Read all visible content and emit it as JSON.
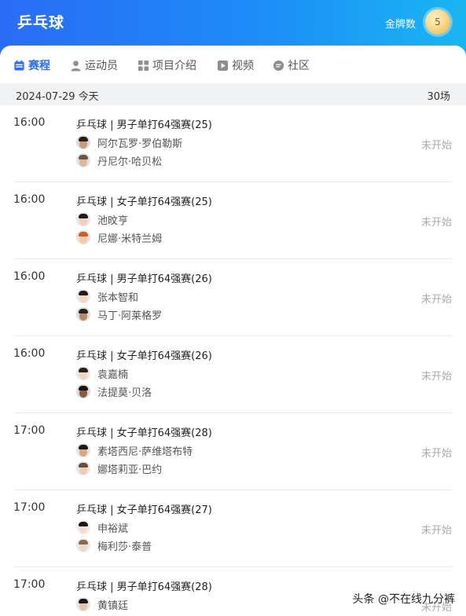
{
  "header": {
    "title": "乒乓球",
    "medal_label": "金牌数",
    "medal_count": "5"
  },
  "nav": {
    "items": [
      {
        "label": "赛程",
        "icon": "calendar-icon",
        "active": true
      },
      {
        "label": "运动员",
        "icon": "person-icon",
        "active": false
      },
      {
        "label": "项目介绍",
        "icon": "grid-icon",
        "active": false
      },
      {
        "label": "视频",
        "icon": "play-icon",
        "active": false
      },
      {
        "label": "社区",
        "icon": "chat-icon",
        "active": false
      }
    ]
  },
  "datebar": {
    "date": "2024-07-29 今天",
    "count": "30场"
  },
  "matches": [
    {
      "time": "16:00",
      "event": "乒乓球 | 男子单打64强赛(25)",
      "player1": "阿尔瓦罗·罗伯勒斯",
      "player2": "丹尼尔·哈贝松",
      "status": "未开始"
    },
    {
      "time": "16:00",
      "event": "乒乓球 | 女子单打64强赛(25)",
      "player1": "池旼亨",
      "player2": "尼娜·米特兰姆",
      "status": "未开始"
    },
    {
      "time": "16:00",
      "event": "乒乓球 | 男子单打64强赛(26)",
      "player1": "张本智和",
      "player2": "马丁·阿莱格罗",
      "status": "未开始"
    },
    {
      "time": "16:00",
      "event": "乒乓球 | 女子单打64强赛(26)",
      "player1": "袁嘉楠",
      "player2": "法提莫·贝洛",
      "status": "未开始"
    },
    {
      "time": "17:00",
      "event": "乒乓球 | 女子单打64强赛(28)",
      "player1": "素塔西尼·萨维塔布特",
      "player2": "娜塔莉亚·巴约",
      "status": "未开始"
    },
    {
      "time": "17:00",
      "event": "乒乓球 | 女子单打64强赛(27)",
      "player1": "申裕斌",
      "player2": "梅利莎·泰普",
      "status": "未开始"
    },
    {
      "time": "17:00",
      "event": "乒乓球 | 男子单打64强赛(28)",
      "player1": "黄镇廷",
      "player2": "",
      "status": "未开始"
    }
  ],
  "watermark": "头条 @不在线九分裤"
}
